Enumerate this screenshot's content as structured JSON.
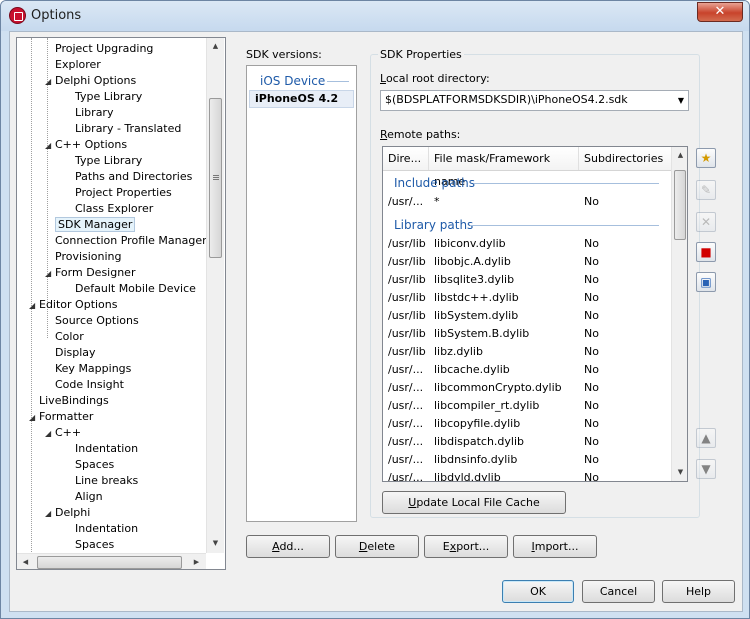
{
  "window": {
    "title": "Options",
    "close_glyph": "✕"
  },
  "tree": {
    "items": [
      {
        "label": "Project Upgrading",
        "indent": 2,
        "expander": ""
      },
      {
        "label": "Explorer",
        "indent": 2,
        "expander": ""
      },
      {
        "label": "Delphi Options",
        "indent": 2,
        "expander": "◢"
      },
      {
        "label": "Type Library",
        "indent": 3,
        "expander": ""
      },
      {
        "label": "Library",
        "indent": 3,
        "expander": ""
      },
      {
        "label": "Library - Translated",
        "indent": 3,
        "expander": ""
      },
      {
        "label": "C++ Options",
        "indent": 2,
        "expander": "◢"
      },
      {
        "label": "Type Library",
        "indent": 3,
        "expander": ""
      },
      {
        "label": "Paths and Directories",
        "indent": 3,
        "expander": ""
      },
      {
        "label": "Project Properties",
        "indent": 3,
        "expander": ""
      },
      {
        "label": "Class Explorer",
        "indent": 3,
        "expander": ""
      },
      {
        "label": "SDK Manager",
        "indent": 2,
        "expander": "",
        "selected": true
      },
      {
        "label": "Connection Profile Manager",
        "indent": 2,
        "expander": ""
      },
      {
        "label": "Provisioning",
        "indent": 2,
        "expander": ""
      },
      {
        "label": "Form Designer",
        "indent": 2,
        "expander": "◢"
      },
      {
        "label": "Default Mobile Device",
        "indent": 3,
        "expander": ""
      },
      {
        "label": "Editor Options",
        "indent": 1,
        "expander": "◢"
      },
      {
        "label": "Source Options",
        "indent": 2,
        "expander": ""
      },
      {
        "label": "Color",
        "indent": 2,
        "expander": ""
      },
      {
        "label": "Display",
        "indent": 2,
        "expander": ""
      },
      {
        "label": "Key Mappings",
        "indent": 2,
        "expander": ""
      },
      {
        "label": "Code Insight",
        "indent": 2,
        "expander": ""
      },
      {
        "label": "LiveBindings",
        "indent": 1,
        "expander": ""
      },
      {
        "label": "Formatter",
        "indent": 1,
        "expander": "◢"
      },
      {
        "label": "C++",
        "indent": 2,
        "expander": "◢"
      },
      {
        "label": "Indentation",
        "indent": 3,
        "expander": ""
      },
      {
        "label": "Spaces",
        "indent": 3,
        "expander": ""
      },
      {
        "label": "Line breaks",
        "indent": 3,
        "expander": ""
      },
      {
        "label": "Align",
        "indent": 3,
        "expander": ""
      },
      {
        "label": "Delphi",
        "indent": 2,
        "expander": "◢"
      },
      {
        "label": "Indentation",
        "indent": 3,
        "expander": ""
      },
      {
        "label": "Spaces",
        "indent": 3,
        "expander": ""
      }
    ]
  },
  "sdk": {
    "label": "SDK versions:",
    "group": "iOS Device",
    "item": "iPhoneOS 4.2"
  },
  "props": {
    "legend": "SDK Properties",
    "lrd_label": "Local root directory:",
    "lrd_value": "$(BDSPLATFORMSDKSDIR)\\iPhoneOS4.2.sdk",
    "remote_label": "Remote paths:",
    "columns": [
      "Dire...",
      "File mask/Framework name",
      "Subdirectories"
    ],
    "include_group": "Include paths",
    "include_rows": [
      [
        "/usr/...",
        "*",
        "No"
      ]
    ],
    "library_group": "Library paths",
    "library_rows": [
      [
        "/usr/lib",
        "libiconv.dylib",
        "No"
      ],
      [
        "/usr/lib",
        "libobjc.A.dylib",
        "No"
      ],
      [
        "/usr/lib",
        "libsqlite3.dylib",
        "No"
      ],
      [
        "/usr/lib",
        "libstdc++.dylib",
        "No"
      ],
      [
        "/usr/lib",
        "libSystem.dylib",
        "No"
      ],
      [
        "/usr/lib",
        "libSystem.B.dylib",
        "No"
      ],
      [
        "/usr/lib",
        "libz.dylib",
        "No"
      ],
      [
        "/usr/...",
        "libcache.dylib",
        "No"
      ],
      [
        "/usr/...",
        "libcommonCrypto.dylib",
        "No"
      ],
      [
        "/usr/...",
        "libcompiler_rt.dylib",
        "No"
      ],
      [
        "/usr/...",
        "libcopyfile.dylib",
        "No"
      ],
      [
        "/usr/...",
        "libdispatch.dylib",
        "No"
      ],
      [
        "/usr/...",
        "libdnsinfo.dylib",
        "No"
      ],
      [
        "/usr/...",
        "libdyld.dylib",
        "No"
      ]
    ],
    "update_btn": {
      "pre": "",
      "u": "U",
      "post": "pdate Local File Cache"
    }
  },
  "buttons": {
    "add": {
      "u": "A",
      "post": "dd..."
    },
    "delete": {
      "u": "D",
      "post": "elete"
    },
    "export": {
      "pre": "E",
      "u": "x",
      "post": "port..."
    },
    "import": {
      "u": "I",
      "post": "mport..."
    },
    "ok": "OK",
    "cancel": "Cancel",
    "help": "Help"
  },
  "colors": {
    "group_text": "#1e5aa8",
    "selection": "#e5f3fb"
  }
}
